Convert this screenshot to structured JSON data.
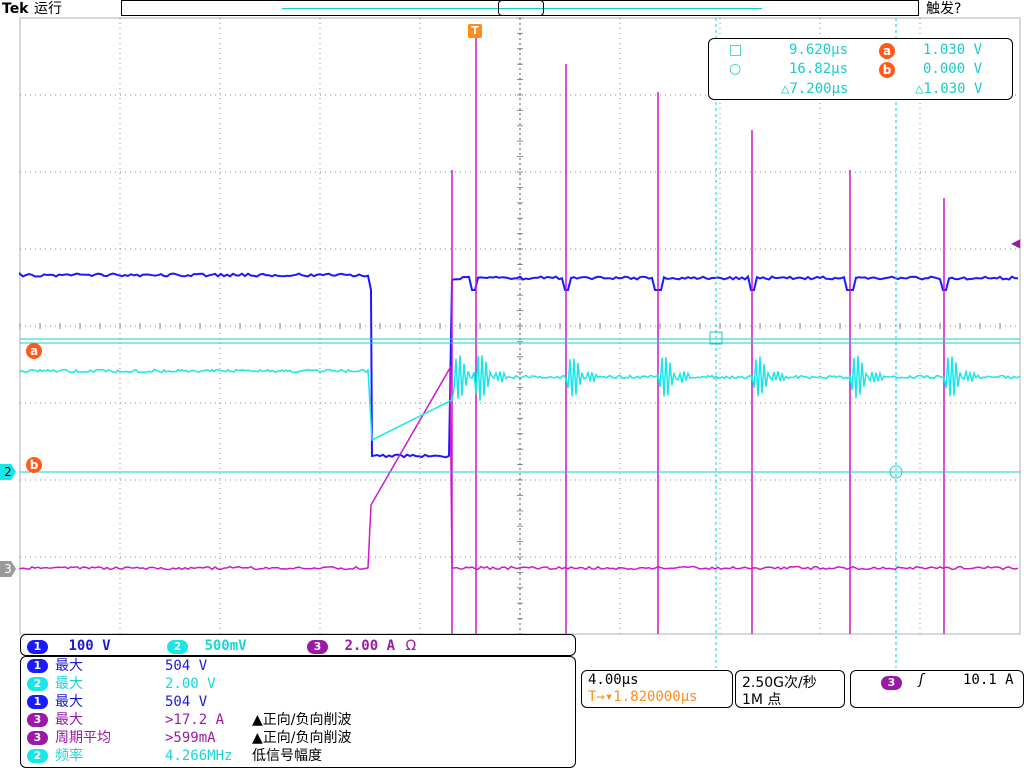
{
  "header": {
    "brand": "Tek",
    "run_state": "运行",
    "trigger_state": "触发?"
  },
  "markers": {
    "trigger_T": "T",
    "cursor_a": "a",
    "cursor_b": "b",
    "ch2_ref": "2",
    "ch3_ref": "3"
  },
  "channels": [
    {
      "num": "1",
      "scale": "100 V"
    },
    {
      "num": "2",
      "scale": "500mV"
    },
    {
      "num": "3",
      "scale": "2.00 A",
      "suffix": "Ω"
    }
  ],
  "measurements": [
    {
      "ch": "1",
      "name": "最大",
      "value": "504 V",
      "note": ""
    },
    {
      "ch": "2",
      "name": "最大",
      "value": "2.00 V",
      "note": ""
    },
    {
      "ch": "1",
      "name": "最大",
      "value": "504 V",
      "note": ""
    },
    {
      "ch": "3",
      "name": "最大",
      "value": ">17.2 A",
      "note": "▲正向/负向削波"
    },
    {
      "ch": "3",
      "name": "周期平均",
      "value": ">599mA",
      "note": "▲正向/负向削波"
    },
    {
      "ch": "2",
      "name": "频率",
      "value": "4.266MHz",
      "note": "低信号幅度"
    }
  ],
  "timebase": {
    "scale": "4.00µs",
    "trigger_delay": "T→▾1.820000µs"
  },
  "acquisition": {
    "rate": "2.50G次/秒",
    "points": "1M 点"
  },
  "trigger": {
    "channel": "3",
    "slope": "ʃ",
    "level": "10.1 A"
  },
  "cursors": {
    "row1_time": "9.620µs",
    "row1_mark": "a",
    "row1_val": "1.030 V",
    "row2_time": "16.82µs",
    "row2_mark": "b",
    "row2_val": "0.000 V",
    "delta_time": "△7.200µs",
    "delta_val": "△1.030 V"
  },
  "colors": {
    "ch1": "#1a1aff",
    "ch2": "#19e6e6",
    "ch3": "#cc19cc",
    "cursor": "#ff5a1a",
    "trigger": "#ff8c1a",
    "grid": "#8a8a8a"
  },
  "waveform": {
    "ch1_high_level": "504 V",
    "ch3_max": ">17.2 A",
    "ch2_freq": "4.266MHz"
  }
}
